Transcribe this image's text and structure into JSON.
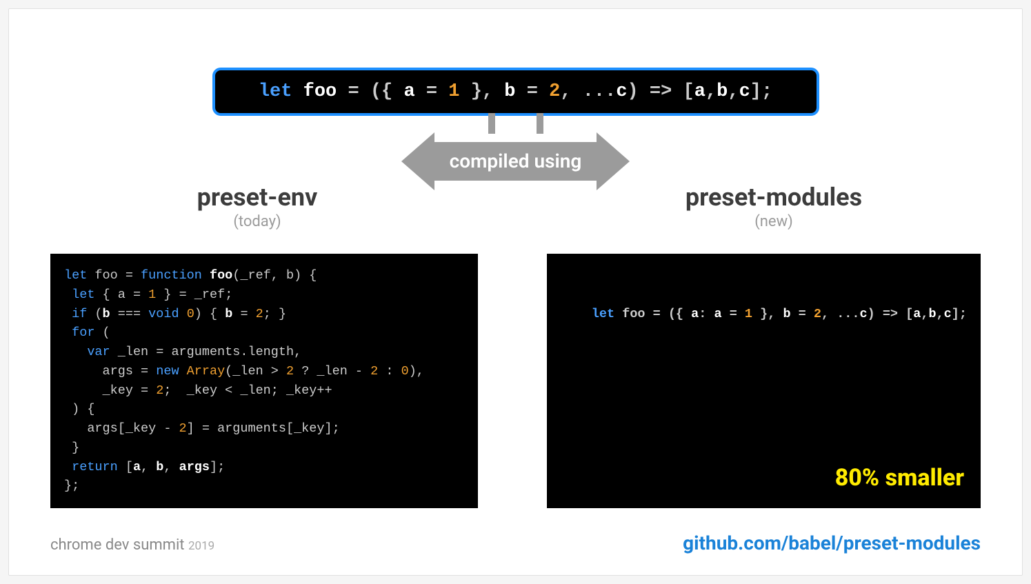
{
  "source": {
    "tokens": [
      {
        "t": "let ",
        "c": "kw"
      },
      {
        "t": "foo ",
        "c": "id"
      },
      {
        "t": "= ({ ",
        "c": "pale"
      },
      {
        "t": "a ",
        "c": "id"
      },
      {
        "t": "= ",
        "c": "pale"
      },
      {
        "t": "1 ",
        "c": "num"
      },
      {
        "t": "}, ",
        "c": "pale"
      },
      {
        "t": "b ",
        "c": "id"
      },
      {
        "t": "= ",
        "c": "pale"
      },
      {
        "t": "2",
        "c": "num"
      },
      {
        "t": ", ...",
        "c": "pale"
      },
      {
        "t": "c",
        "c": "id"
      },
      {
        "t": ") => [",
        "c": "pale"
      },
      {
        "t": "a",
        "c": "id"
      },
      {
        "t": ",",
        "c": "pale"
      },
      {
        "t": "b",
        "c": "id"
      },
      {
        "t": ",",
        "c": "pale"
      },
      {
        "t": "c",
        "c": "id"
      },
      {
        "t": "];",
        "c": "pale"
      }
    ]
  },
  "arrow_label": "compiled using",
  "left": {
    "title": "preset-env",
    "subtitle": "(today)",
    "code_tokens": [
      {
        "t": "let ",
        "c": "kw"
      },
      {
        "t": "foo = ",
        "c": "pale"
      },
      {
        "t": "function ",
        "c": "kw"
      },
      {
        "t": "foo",
        "c": "id"
      },
      {
        "t": "(_ref, b) {",
        "c": "pale"
      },
      {
        "t": "\n "
      },
      {
        "t": "let ",
        "c": "kw"
      },
      {
        "t": "{ a = ",
        "c": "pale"
      },
      {
        "t": "1 ",
        "c": "num"
      },
      {
        "t": "} = _ref;",
        "c": "pale"
      },
      {
        "t": "\n "
      },
      {
        "t": "if ",
        "c": "kw"
      },
      {
        "t": "(",
        "c": "pale"
      },
      {
        "t": "b ",
        "c": "id"
      },
      {
        "t": "=== ",
        "c": "pale"
      },
      {
        "t": "void ",
        "c": "kw"
      },
      {
        "t": "0",
        "c": "num"
      },
      {
        "t": ") { ",
        "c": "pale"
      },
      {
        "t": "b ",
        "c": "id"
      },
      {
        "t": "= ",
        "c": "pale"
      },
      {
        "t": "2",
        "c": "num"
      },
      {
        "t": "; }",
        "c": "pale"
      },
      {
        "t": "\n "
      },
      {
        "t": "for ",
        "c": "kw"
      },
      {
        "t": "(",
        "c": "pale"
      },
      {
        "t": "\n   "
      },
      {
        "t": "var ",
        "c": "kw"
      },
      {
        "t": "_len = arguments.length,",
        "c": "pale"
      },
      {
        "t": "\n     "
      },
      {
        "t": "args = ",
        "c": "pale"
      },
      {
        "t": "new ",
        "c": "kw"
      },
      {
        "t": "Array",
        "c": "fn"
      },
      {
        "t": "(_len > ",
        "c": "pale"
      },
      {
        "t": "2 ",
        "c": "num"
      },
      {
        "t": "? _len - ",
        "c": "pale"
      },
      {
        "t": "2 ",
        "c": "num"
      },
      {
        "t": ": ",
        "c": "pale"
      },
      {
        "t": "0",
        "c": "num"
      },
      {
        "t": "),",
        "c": "pale"
      },
      {
        "t": "\n     "
      },
      {
        "t": "_key = ",
        "c": "pale"
      },
      {
        "t": "2",
        "c": "num"
      },
      {
        "t": ";  _key < _len; _key++",
        "c": "pale"
      },
      {
        "t": "\n "
      },
      {
        "t": ") {",
        "c": "pale"
      },
      {
        "t": "\n   "
      },
      {
        "t": "args[_key - ",
        "c": "pale"
      },
      {
        "t": "2",
        "c": "num"
      },
      {
        "t": "] = arguments[_key];",
        "c": "pale"
      },
      {
        "t": "\n "
      },
      {
        "t": "}",
        "c": "pale"
      },
      {
        "t": "\n "
      },
      {
        "t": "return ",
        "c": "kw"
      },
      {
        "t": "[",
        "c": "pale"
      },
      {
        "t": "a",
        "c": "id"
      },
      {
        "t": ", ",
        "c": "pale"
      },
      {
        "t": "b",
        "c": "id"
      },
      {
        "t": ", ",
        "c": "pale"
      },
      {
        "t": "args",
        "c": "id"
      },
      {
        "t": "];",
        "c": "pale"
      },
      {
        "t": "\n"
      },
      {
        "t": "};",
        "c": "pale"
      }
    ]
  },
  "right": {
    "title": "preset-modules",
    "subtitle": "(new)",
    "code_tokens": [
      {
        "t": "let ",
        "c": "kw"
      },
      {
        "t": "foo = ({ ",
        "c": "pale"
      },
      {
        "t": "a",
        "c": "id"
      },
      {
        "t": ": ",
        "c": "pale"
      },
      {
        "t": "a ",
        "c": "id"
      },
      {
        "t": "= ",
        "c": "pale"
      },
      {
        "t": "1 ",
        "c": "num"
      },
      {
        "t": "}, ",
        "c": "pale"
      },
      {
        "t": "b ",
        "c": "id"
      },
      {
        "t": "= ",
        "c": "pale"
      },
      {
        "t": "2",
        "c": "num"
      },
      {
        "t": ", ...",
        "c": "pale"
      },
      {
        "t": "c",
        "c": "id"
      },
      {
        "t": ") => [",
        "c": "pale"
      },
      {
        "t": "a",
        "c": "id"
      },
      {
        "t": ",",
        "c": "pale"
      },
      {
        "t": "b",
        "c": "id"
      },
      {
        "t": ",",
        "c": "pale"
      },
      {
        "t": "c",
        "c": "id"
      },
      {
        "t": "];",
        "c": "pale"
      }
    ],
    "badge": "80% smaller"
  },
  "footer": {
    "event": "chrome dev summit",
    "year": "2019",
    "link": "github.com/babel/preset-modules"
  }
}
